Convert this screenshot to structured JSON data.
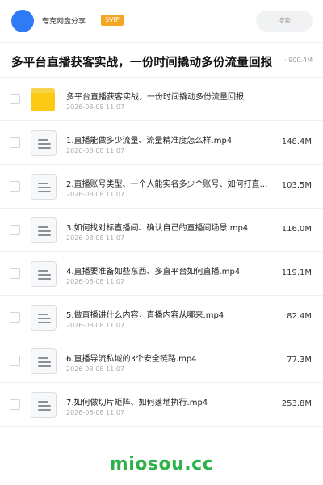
{
  "header": {
    "app_name": "夸克网盘分享",
    "badge": "SVIP",
    "search_label": "搜索"
  },
  "title": {
    "text": "多平台直播获客实战，一份时间撬动多份流量回报",
    "meta": "· 900.4M"
  },
  "colors": {
    "accent": "#2f7bf5",
    "badge": "#f5a623",
    "folder": "#fcc915",
    "watermark": "#2db24a"
  },
  "files": [
    {
      "type": "folder",
      "icon": "folder-icon",
      "name": "多平台直播获客实战，一份时间撬动多份流量回报",
      "date": "2026-08-08 11:07",
      "size": ""
    },
    {
      "type": "file",
      "icon": "document-icon",
      "name": "1.直播能做多少流量、流量精准度怎么样.mp4",
      "date": "2026-08-08 11:07",
      "size": "148.4M"
    },
    {
      "type": "file",
      "icon": "document-icon",
      "name": "2.直播账号类型、一个人能实名多少个账号、如何打直…",
      "date": "2026-08-08 11:07",
      "size": "103.5M"
    },
    {
      "type": "file",
      "icon": "document-icon",
      "name": "3.如何找对标直播间、确认自己的直播间场景.mp4",
      "date": "2026-08-08 11:07",
      "size": "116.0M"
    },
    {
      "type": "file",
      "icon": "document-icon",
      "name": "4.直播要准备如些东西、多直平台如何直播.mp4",
      "date": "2026-08-08 11:07",
      "size": "119.1M"
    },
    {
      "type": "file",
      "icon": "document-icon",
      "name": "5.做直播讲什么内容，直播内容从哪来.mp4",
      "date": "2026-08-08 11:07",
      "size": "82.4M"
    },
    {
      "type": "file",
      "icon": "document-icon",
      "name": "6.直播导流私域的3个安全链路.mp4",
      "date": "2026-08-08 11:07",
      "size": "77.3M"
    },
    {
      "type": "file",
      "icon": "document-icon",
      "name": "7.如何做切片矩阵、如何落地执行.mp4",
      "date": "2026-08-08 11:07",
      "size": "253.8M"
    }
  ],
  "watermark": "miosou.cc"
}
